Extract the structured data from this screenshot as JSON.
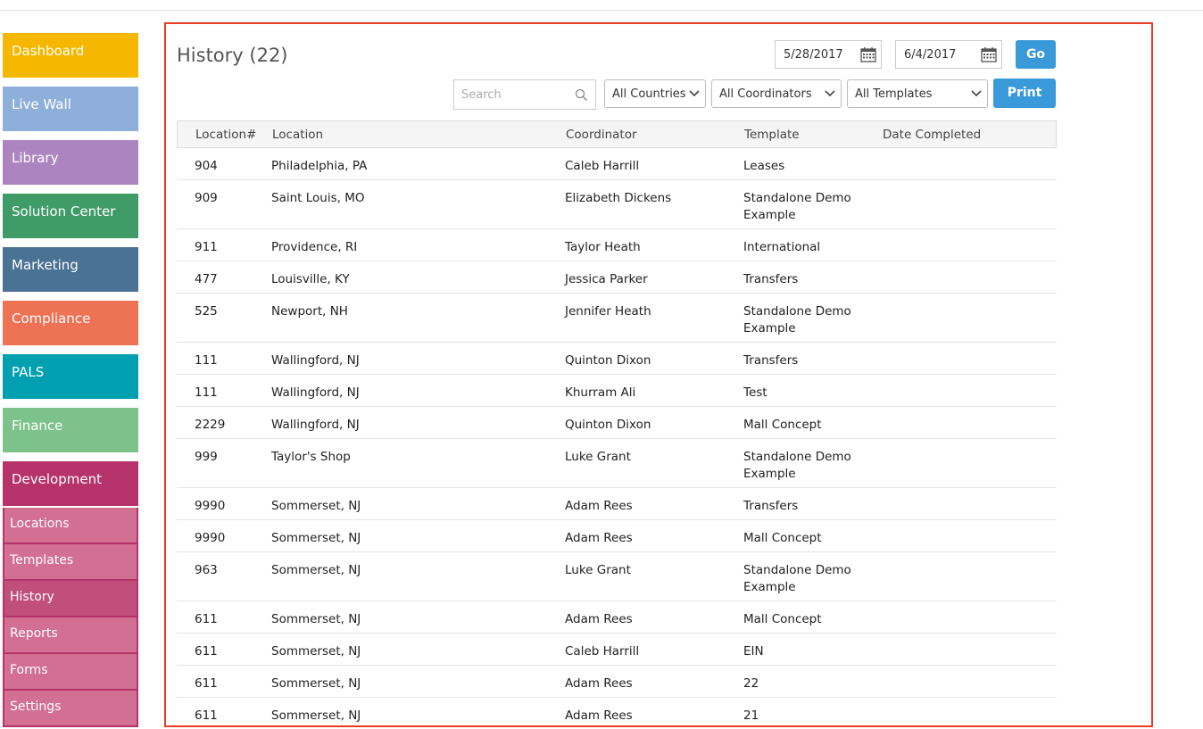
{
  "sidebar": {
    "items": [
      {
        "label": "Dashboard",
        "color": "#f5b700"
      },
      {
        "label": "Live Wall",
        "color": "#8fafdb"
      },
      {
        "label": "Library",
        "color": "#ac85c0"
      },
      {
        "label": "Solution Center",
        "color": "#3f9c67"
      },
      {
        "label": "Marketing",
        "color": "#4a7294"
      },
      {
        "label": "Compliance",
        "color": "#ee7354"
      },
      {
        "label": "PALS",
        "color": "#00a0b0"
      },
      {
        "label": "Finance",
        "color": "#7dc28a"
      }
    ],
    "section": {
      "label": "Development",
      "color": "#b5336a"
    },
    "subitems": [
      {
        "label": "Locations",
        "active": false
      },
      {
        "label": "Templates",
        "active": false
      },
      {
        "label": "History",
        "active": true
      },
      {
        "label": "Reports",
        "active": false
      },
      {
        "label": "Forms",
        "active": false
      },
      {
        "label": "Settings",
        "active": false
      }
    ]
  },
  "main": {
    "title": "History (22)",
    "date_from": "5/28/2017",
    "date_to": "6/4/2017",
    "go_label": "Go",
    "print_label": "Print",
    "search_placeholder": "Search",
    "filters": {
      "countries": "All Countries",
      "coordinators": "All Coordinators",
      "templates": "All Templates"
    },
    "accent_color": "#3a9ad9",
    "highlight_border_color": "#ea3b23"
  },
  "table": {
    "headers": [
      "Location#",
      "Location",
      "Coordinator",
      "Template",
      "Date Completed"
    ],
    "rows": [
      {
        "num": "904",
        "location": "Philadelphia, PA",
        "coordinator": "Caleb Harrill",
        "template": "Leases",
        "date": ""
      },
      {
        "num": "909",
        "location": "Saint Louis, MO",
        "coordinator": "Elizabeth Dickens",
        "template": "Standalone Demo Example",
        "date": ""
      },
      {
        "num": "911",
        "location": "Providence, RI",
        "coordinator": "Taylor Heath",
        "template": "International",
        "date": ""
      },
      {
        "num": "477",
        "location": "Louisville, KY",
        "coordinator": "Jessica Parker",
        "template": "Transfers",
        "date": ""
      },
      {
        "num": "525",
        "location": "Newport, NH",
        "coordinator": "Jennifer Heath",
        "template": "Standalone Demo Example",
        "date": ""
      },
      {
        "num": "111",
        "location": "Wallingford, NJ",
        "coordinator": "Quinton Dixon",
        "template": "Transfers",
        "date": ""
      },
      {
        "num": "111",
        "location": "Wallingford, NJ",
        "coordinator": "Khurram Ali",
        "template": "Test",
        "date": ""
      },
      {
        "num": "2229",
        "location": "Wallingford, NJ",
        "coordinator": "Quinton Dixon",
        "template": "Mall Concept",
        "date": ""
      },
      {
        "num": "999",
        "location": "Taylor's Shop",
        "coordinator": "Luke Grant",
        "template": "Standalone Demo Example",
        "date": ""
      },
      {
        "num": "9990",
        "location": "Sommerset, NJ",
        "coordinator": "Adam Rees",
        "template": "Transfers",
        "date": ""
      },
      {
        "num": "9990",
        "location": "Sommerset, NJ",
        "coordinator": "Adam Rees",
        "template": "Mall Concept",
        "date": ""
      },
      {
        "num": "963",
        "location": "Sommerset, NJ",
        "coordinator": "Luke Grant",
        "template": "Standalone Demo Example",
        "date": ""
      },
      {
        "num": "611",
        "location": "Sommerset, NJ",
        "coordinator": "Adam Rees",
        "template": "Mall Concept",
        "date": ""
      },
      {
        "num": "611",
        "location": "Sommerset, NJ",
        "coordinator": "Caleb Harrill",
        "template": "EIN",
        "date": ""
      },
      {
        "num": "611",
        "location": "Sommerset, NJ",
        "coordinator": "Adam Rees",
        "template": "22",
        "date": ""
      },
      {
        "num": "611",
        "location": "Sommerset, NJ",
        "coordinator": "Adam Rees",
        "template": "21",
        "date": ""
      }
    ]
  },
  "icons": {
    "calendar": "calendar-icon",
    "search": "search-icon",
    "dropdown": "chevron-down-icon"
  }
}
